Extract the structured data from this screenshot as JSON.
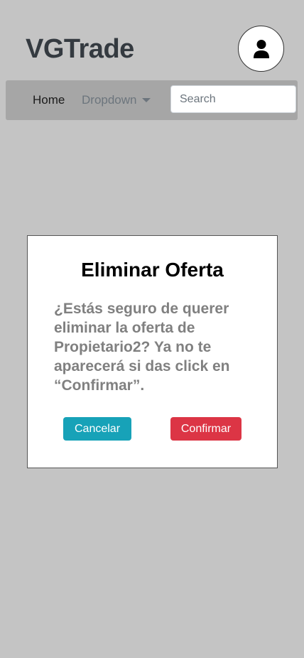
{
  "header": {
    "logo": "VGTrade",
    "avatar_icon": "user-icon"
  },
  "navbar": {
    "home_label": "Home",
    "dropdown_label": "Dropdown",
    "search_placeholder": "Search",
    "search_value": ""
  },
  "modal": {
    "title": "Eliminar Oferta",
    "message": "¿Estás seguro de querer eliminar la oferta de Propietario2? Ya no te aparecerá si das click en “Confirmar”.",
    "cancel_label": "Cancelar",
    "confirm_label": "Confirmar"
  },
  "colors": {
    "background": "#c4c4c4",
    "navbar": "#a6a6a6",
    "cancel_button": "#17a2b8",
    "confirm_button": "#dc3545"
  }
}
